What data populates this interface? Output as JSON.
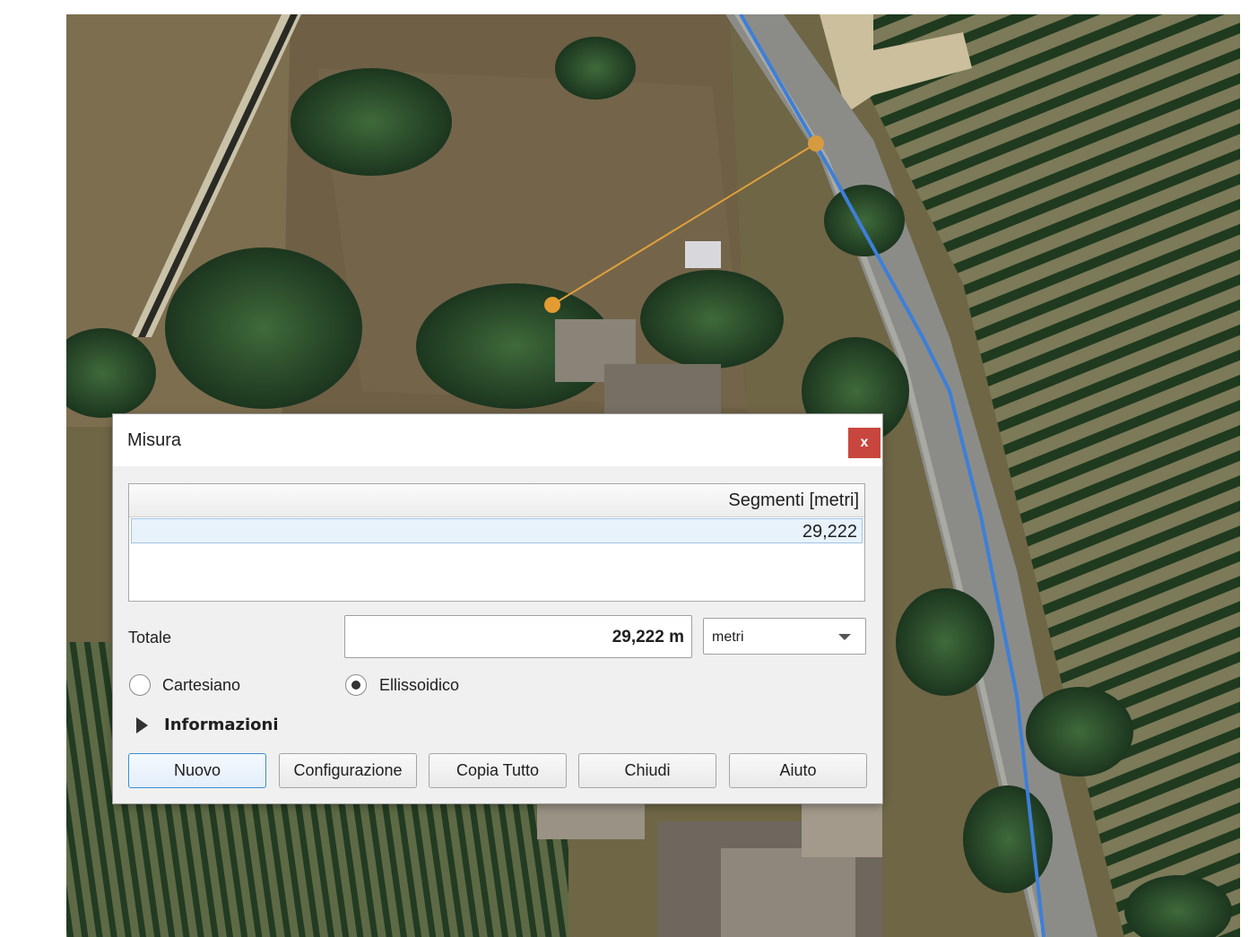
{
  "dialog": {
    "title": "Misura",
    "close_label": "x",
    "segments_header": "Segmenti [metri]",
    "segments": [
      "29,222"
    ],
    "total_label": "Totale",
    "total_value": "29,222 m",
    "unit_selected": "metri",
    "radio_cartesian_label": "Cartesiano",
    "radio_ellipsoidal_label": "Ellissoidico",
    "ellipsoidal_selected": true,
    "info_label": "Informazioni",
    "buttons": {
      "new": "Nuovo",
      "config": "Configurazione",
      "copy_all": "Copia Tutto",
      "close": "Chiudi",
      "help": "Aiuto"
    }
  },
  "map": {
    "road_route_color": "#3d7fd8",
    "measure_line_color": "#e2a13a"
  }
}
